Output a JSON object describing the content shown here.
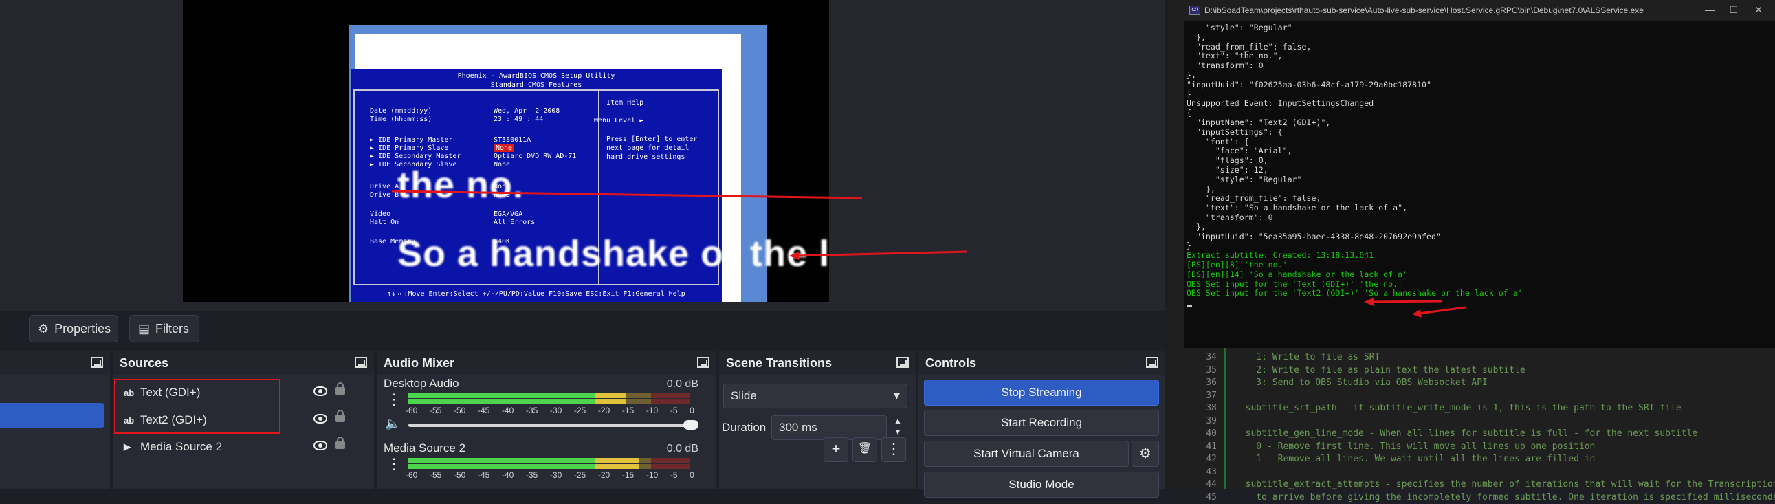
{
  "preview": {
    "bios": {
      "title_line1": "Phoenix - AwardBIOS CMOS Setup Utility",
      "title_line2": "Standard CMOS Features",
      "rows": [
        {
          "label": "Date (mm:dd:yy)",
          "value": "Wed, Apr  2 2008"
        },
        {
          "label": "Time (hh:mm:ss)",
          "value": "23 : 49 : 44"
        },
        {
          "label": "► IDE Primary Master",
          "value": "ST380011A"
        },
        {
          "label": "► IDE Primary Slave",
          "value": "None"
        },
        {
          "label": "► IDE Secondary Master",
          "value": "Optiarc DVD RW AD-71"
        },
        {
          "label": "► IDE Secondary Slave",
          "value": "None"
        },
        {
          "label": "Drive A",
          "value": "None"
        },
        {
          "label": "Drive B",
          "value": "None"
        },
        {
          "label": "Video",
          "value": "EGA/VGA"
        },
        {
          "label": "Halt On",
          "value": "All Errors"
        },
        {
          "label": "Base Memory",
          "value": "640K"
        }
      ],
      "help_title": "Item Help",
      "help_level": "Menu Level  ►",
      "help_text": "Press [Enter] to enter\nnext page for detail\nhard drive settings",
      "footer": "↑↓→←:Move  Enter:Select  +/-/PU/PD:Value  F10:Save  ESC:Exit  F1:General Help"
    },
    "subtitle_line1": "the no.",
    "subtitle_line2": "So a handshake or the lack of a"
  },
  "toolbar": {
    "properties_label": "Properties",
    "filters_label": "Filters"
  },
  "docks": {
    "sources": {
      "title": "Sources",
      "items": [
        {
          "icon": "ab",
          "label": "Text (GDI+)"
        },
        {
          "icon": "ab",
          "label": "Text2 (GDI+)"
        },
        {
          "icon": "▶",
          "label": "Media Source 2"
        }
      ]
    },
    "audio": {
      "title": "Audio Mixer",
      "channels": [
        {
          "name": "Desktop Audio",
          "db": "0.0 dB",
          "level": 0.77
        },
        {
          "name": "Media Source 2",
          "db": "0.0 dB",
          "level": 0.82
        }
      ],
      "ticks": [
        "-60",
        "-55",
        "-50",
        "-45",
        "-40",
        "-35",
        "-30",
        "-25",
        "-20",
        "-15",
        "-10",
        "-5",
        "0"
      ]
    },
    "transitions": {
      "title": "Scene Transitions",
      "selected": "Slide",
      "duration_label": "Duration",
      "duration_value": "300 ms"
    },
    "controls": {
      "title": "Controls",
      "stop_streaming": "Stop Streaming",
      "start_recording": "Start Recording",
      "start_virtual_camera": "Start Virtual Camera",
      "studio_mode": "Studio Mode"
    }
  },
  "console": {
    "title": "D:\\ibSoadTeam\\projects\\rthauto-sub-service\\Auto-live-sub-service\\Host.Service.gRPC\\bin\\Debug\\net7.0\\ALSService.exe",
    "lines": [
      "    \"style\": \"Regular\"",
      "  },",
      "  \"read_from_file\": false,",
      "  \"text\": \"the no.\",",
      "  \"transform\": 0",
      "},",
      "\"inputUuid\": \"f02625aa-03b6-48cf-a179-29a0bc187810\"",
      "}",
      "Unsupported Event: InputSettingsChanged",
      "{",
      "  \"inputName\": \"Text2 (GDI+)\",",
      "  \"inputSettings\": {",
      "    \"font\": {",
      "      \"face\": \"Arial\",",
      "      \"flags\": 0,",
      "      \"size\": 12,",
      "      \"style\": \"Regular\"",
      "    },",
      "    \"read_from_file\": false,",
      "    \"text\": \"So a handshake or the lack of a\",",
      "    \"transform\": 0",
      "  },",
      "  \"inputUuid\": \"5ea35a95-baec-4338-8e48-207692e9afed\"",
      "}"
    ],
    "green_lines": [
      "Extract subtitle: Created: 13:18:13.641",
      "[BS][en][8] 'the no.'",
      "[BS][en][14] 'So a handshake or the lack of a'",
      "OBS Set input for the 'Text (GDI+)' 'the no.'",
      "OBS Set input for the 'Text2 (GDI+)' 'So a handshake or the lack of a'"
    ]
  },
  "editor": {
    "line_numbers": [
      "34",
      "35",
      "36",
      "37",
      "38",
      "39",
      "40",
      "41",
      "42",
      "43",
      "44",
      "45"
    ],
    "lines": [
      "    1: Write to file as SRT",
      "    2: Write to file as plain text the latest subtitle",
      "    3: Send to OBS Studio via OBS Websocket API",
      "",
      "  subtitle_srt_path - if subtitle_write_mode is 1, this is the path to the SRT file",
      "",
      "  subtitle_gen_line_mode - When all lines for subtitle is full - for the next subtitle",
      "    0 - Remove first line. This will move all lines up one position",
      "    1 - Remove all lines. We wait until all the lines are filled in",
      "",
      "  subtitle_extract_attempts - specifies the number of iterations that will wait for the Transcription",
      "    to arrive before giving the incompletely formed subtitle. One iteration is specified milliseconds in `s"
    ]
  },
  "colors": {
    "accent_blue": "#2d5cc3",
    "highlight_red": "#e0161b",
    "console_green": "#16c60c",
    "bios_blue": "#0a14a8"
  }
}
